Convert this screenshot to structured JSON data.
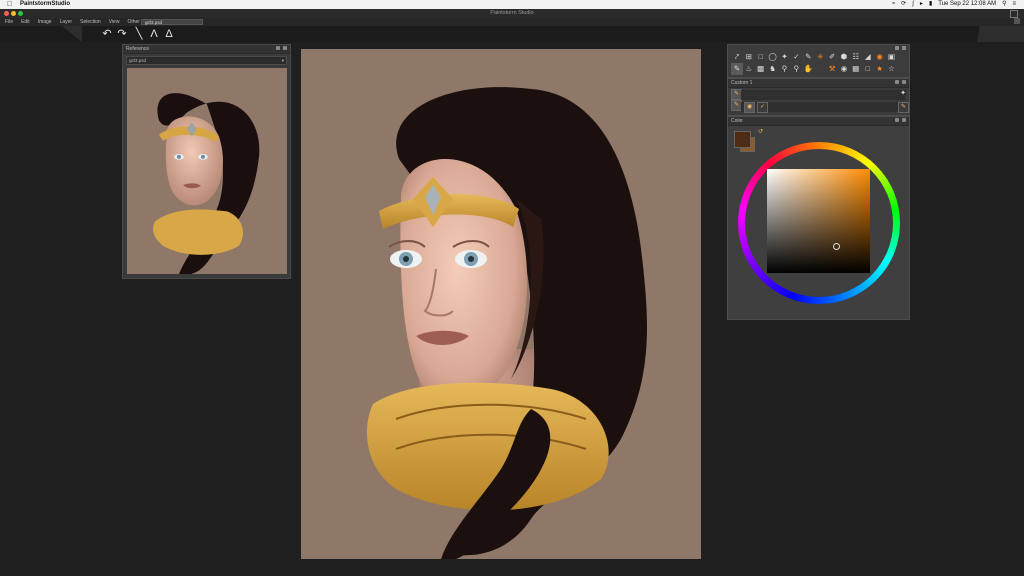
{
  "menubar": {
    "app_name": "PaintstormStudio",
    "clock": "Tue Sep 22  12:08 AM",
    "icons": [
      "wifi-icon",
      "time-machine-icon",
      "bluetooth-icon",
      "volume-icon",
      "battery-icon",
      "search-icon",
      "list-icon"
    ]
  },
  "window": {
    "title": "Paintstorm Studio",
    "menus": [
      "File",
      "Edit",
      "Image",
      "Layer",
      "Selection",
      "View",
      "Other"
    ],
    "file_tab": "girl3.psd"
  },
  "toolbar": {
    "icons": [
      "undo-icon",
      "redo-icon",
      "brush-icon",
      "symmetry-icon",
      "pen-icon"
    ]
  },
  "reference_panel": {
    "title": "Reference",
    "selected_file": "girl3.psd"
  },
  "tool_palette": {
    "row1": [
      "move",
      "crop",
      "select-rect",
      "lasso",
      "magic-wand",
      "eyedropper",
      "wand-star",
      "pen",
      "cube",
      "mesh",
      "gradient",
      "stamp",
      "image"
    ],
    "row2": [
      "eraser",
      "fill",
      "smudge",
      "paint-bucket",
      "dodge",
      "zoom",
      "hand",
      "hammer",
      "eye",
      "grid",
      "speech",
      "star-orange",
      "star"
    ]
  },
  "custom_panel": {
    "title": "Custom 1"
  },
  "color_panel": {
    "title": "Color",
    "foreground_color": "#4e2c14",
    "background_color": "#8a5a2c",
    "hue_color": "#ff8c00"
  }
}
